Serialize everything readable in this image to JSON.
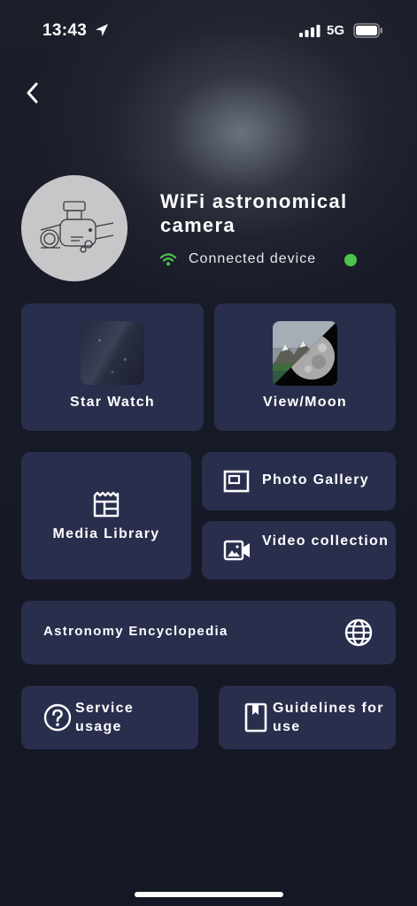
{
  "status_bar": {
    "time": "13:43",
    "network": "5G",
    "icons": [
      "location-arrow-icon",
      "signal-bars-icon",
      "battery-icon"
    ]
  },
  "header": {
    "back_icon": "chevron-left-icon"
  },
  "device": {
    "name": "WiFi astronomical camera",
    "status_text": "Connected device",
    "status_color": "#4fc14f",
    "wifi_color": "#4fc14f"
  },
  "cards": {
    "star_watch": {
      "label": "Star Watch",
      "icon": "star-watch-thumbnail"
    },
    "view_moon": {
      "label": "View/Moon",
      "icon": "view-moon-thumbnail"
    },
    "media_library": {
      "label": "Media Library",
      "icon": "media-library-icon"
    },
    "photo_gallery": {
      "label": "Photo Gallery",
      "icon": "photo-gallery-icon"
    },
    "video_collection": {
      "label": "Video collection",
      "icon": "video-collection-icon"
    },
    "astronomy_encyclopedia": {
      "label": "Astronomy Encyclopedia",
      "icon": "globe-icon"
    },
    "service_usage": {
      "label": "Service usage",
      "icon": "question-circle-icon"
    },
    "guidelines": {
      "label": "Guidelines for use",
      "icon": "book-icon"
    }
  },
  "colors": {
    "background": "#171a26",
    "card": "#2a2e4d",
    "accent_green": "#4fc14f"
  }
}
